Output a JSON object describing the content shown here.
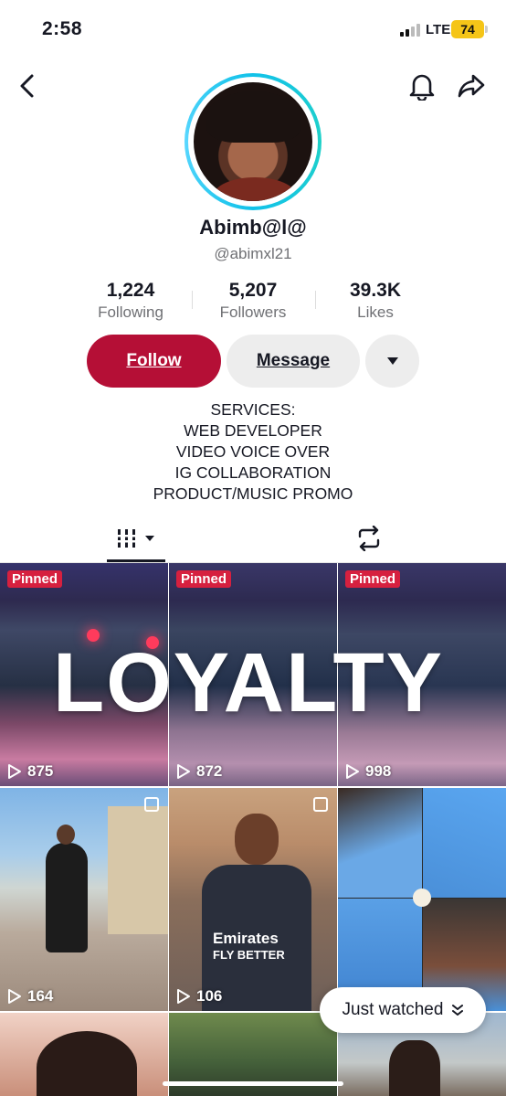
{
  "status_bar": {
    "time": "2:58",
    "network": "LTE",
    "battery": "74"
  },
  "header": {
    "back_icon": "chevron-left-icon",
    "bell_icon": "bell-icon",
    "share_icon": "share-icon"
  },
  "profile": {
    "name": "Abimb@l@",
    "handle": "@abimxl21"
  },
  "stats": {
    "following_count": "1,224",
    "following_label": "Following",
    "followers_count": "5,207",
    "followers_label": "Followers",
    "likes_count": "39.3K",
    "likes_label": "Likes"
  },
  "actions": {
    "follow_label": "Follow",
    "message_label": "Message"
  },
  "bio": [
    "SERVICES:",
    "WEB DEVELOPER",
    "VIDEO VOICE OVER",
    "IG COLLABORATION",
    "PRODUCT/MUSIC PROMO"
  ],
  "tabs": {
    "videos_icon": "videos-grid-icon",
    "reposts_icon": "repost-icon"
  },
  "videos": [
    {
      "pinned": "Pinned",
      "views": "875"
    },
    {
      "pinned": "Pinned",
      "views": "872"
    },
    {
      "pinned": "Pinned",
      "views": "998"
    },
    {
      "views": "164"
    },
    {
      "views": "106"
    },
    {
      "views": ""
    }
  ],
  "overlay_text": "LOYALTY",
  "jersey_text": {
    "line1": "Emirates",
    "line2": "FLY BETTER"
  },
  "just_watched": "Just watched",
  "colors": {
    "accent": "#b50f36",
    "pinned": "#d6203f",
    "ring": "#12c2e9"
  }
}
